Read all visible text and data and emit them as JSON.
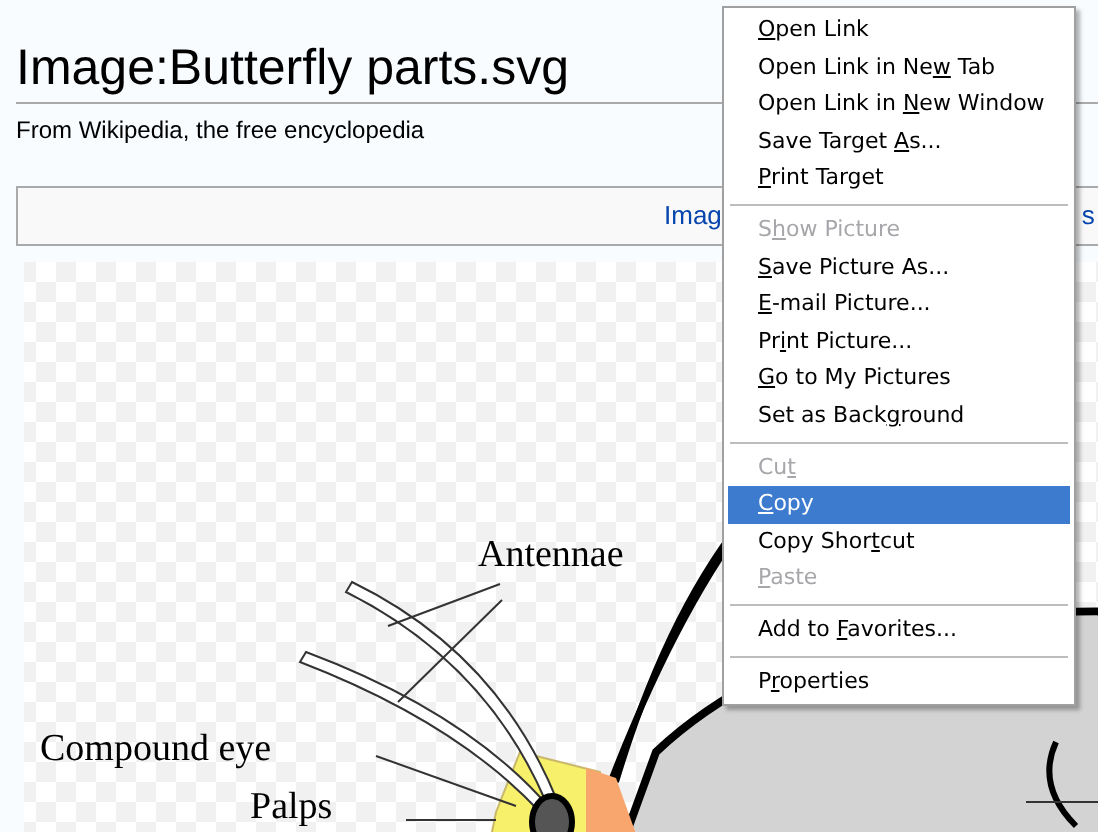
{
  "page": {
    "title": "Image:Butterfly parts.svg",
    "subtitle": "From Wikipedia, the free encyclopedia",
    "tab_box": {
      "text_left": "Imag",
      "text_right": "s"
    }
  },
  "diagram": {
    "labels": [
      {
        "text": "Antennae"
      },
      {
        "text": "Compound eye"
      },
      {
        "text": "Palps"
      }
    ]
  },
  "context_menu": {
    "items": [
      {
        "kind": "item",
        "access_key": "O",
        "text_after": "pen Link",
        "disabled": false,
        "selected": false
      },
      {
        "kind": "item",
        "text_before": "Open Link in Ne",
        "access_key": "w",
        "text_after": " Tab",
        "disabled": false,
        "selected": false
      },
      {
        "kind": "item",
        "text_before": "Open Link in ",
        "access_key": "N",
        "text_after": "ew Window",
        "disabled": false,
        "selected": false
      },
      {
        "kind": "item",
        "text_before": "Save Target ",
        "access_key": "A",
        "text_after": "s...",
        "disabled": false,
        "selected": false
      },
      {
        "kind": "item",
        "access_key": "P",
        "text_after": "rint Target",
        "disabled": false,
        "selected": false
      },
      {
        "kind": "separator"
      },
      {
        "kind": "item",
        "text_before": "S",
        "access_key": "h",
        "text_after": "ow Picture",
        "disabled": true,
        "selected": false
      },
      {
        "kind": "item",
        "access_key": "S",
        "text_after": "ave Picture As...",
        "disabled": false,
        "selected": false
      },
      {
        "kind": "item",
        "access_key": "E",
        "text_after": "-mail Picture...",
        "disabled": false,
        "selected": false
      },
      {
        "kind": "item",
        "text_before": "Pr",
        "access_key": "i",
        "text_after": "nt Picture...",
        "disabled": false,
        "selected": false
      },
      {
        "kind": "item",
        "access_key": "G",
        "text_after": "o to My Pictures",
        "disabled": false,
        "selected": false
      },
      {
        "kind": "item",
        "text_before": "Set as Back",
        "access_key": "g",
        "text_after": "round",
        "disabled": false,
        "selected": false
      },
      {
        "kind": "separator"
      },
      {
        "kind": "item",
        "text_before": "Cu",
        "access_key": "t",
        "disabled": true,
        "selected": false
      },
      {
        "kind": "item",
        "access_key": "C",
        "text_after": "opy",
        "disabled": false,
        "selected": true
      },
      {
        "kind": "item",
        "text_before": "Copy Shor",
        "access_key": "t",
        "text_after": "cut",
        "disabled": false,
        "selected": false
      },
      {
        "kind": "item",
        "access_key": "P",
        "text_after": "aste",
        "disabled": true,
        "selected": false
      },
      {
        "kind": "separator"
      },
      {
        "kind": "item",
        "text_before": "Add to ",
        "access_key": "F",
        "text_after": "avorites...",
        "disabled": false,
        "selected": false
      },
      {
        "kind": "separator"
      },
      {
        "kind": "item",
        "text_before": "P",
        "access_key": "r",
        "text_after": "operties",
        "disabled": false,
        "selected": false
      }
    ]
  }
}
